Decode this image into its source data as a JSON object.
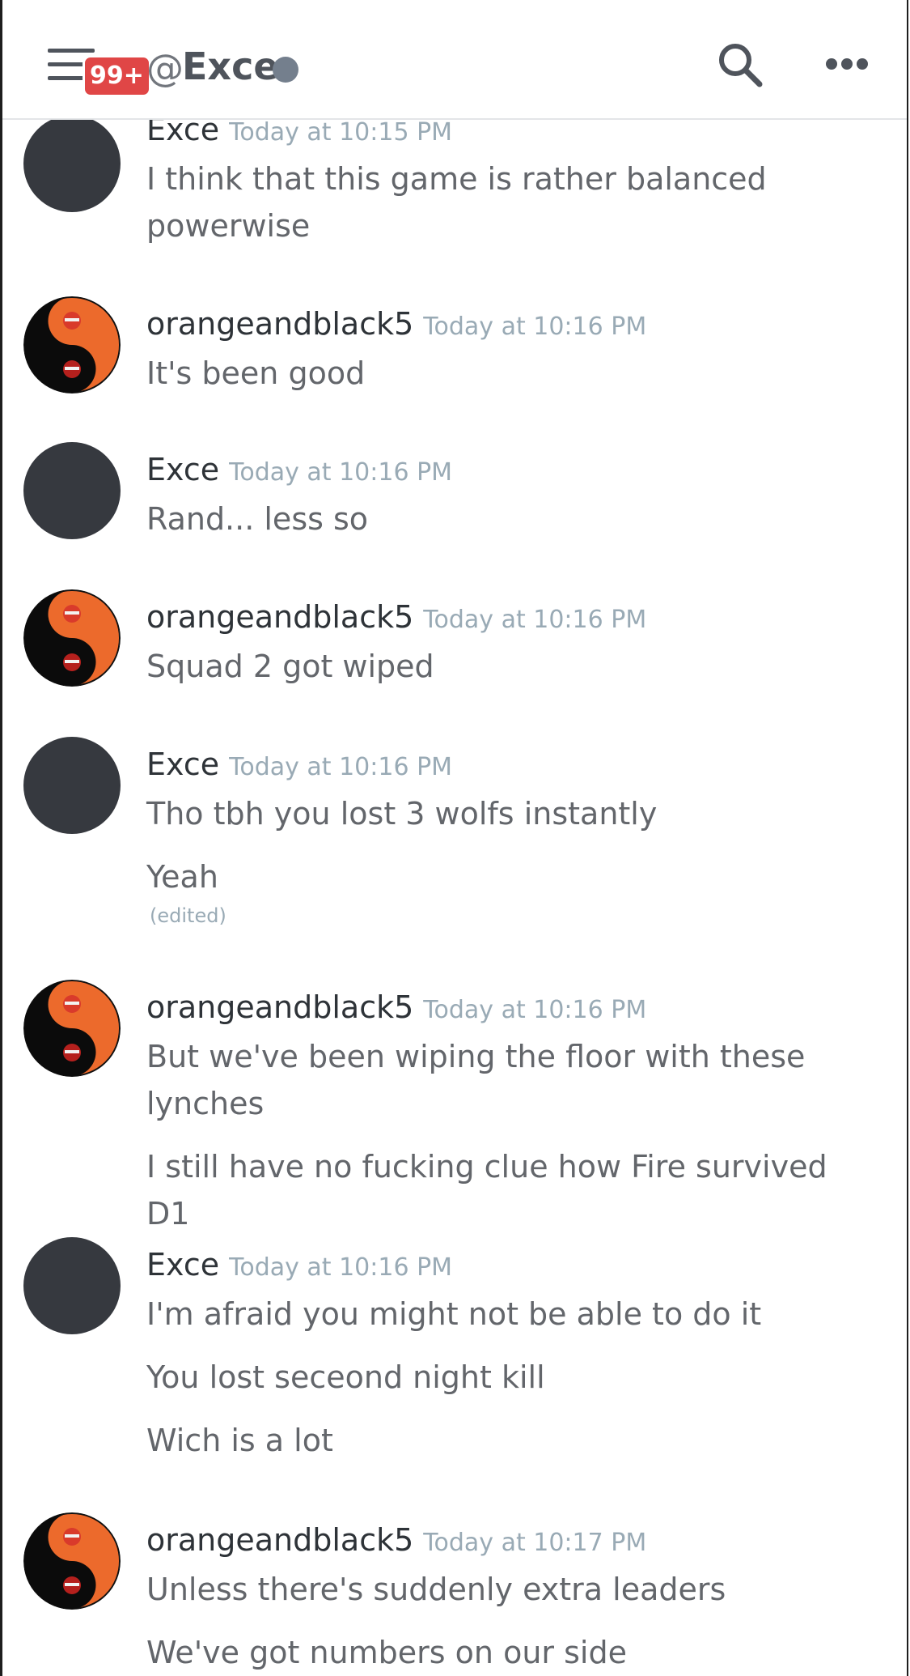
{
  "header": {
    "badge": "99+",
    "at": "@",
    "title": "Exce",
    "colors": {
      "status": "#747f8d",
      "badge": "#e04646"
    }
  },
  "messages": [
    {
      "author": "Exce",
      "time": "Today at 10:15 PM",
      "lines": [
        "I think that this game is rather balanced",
        "powerwise"
      ]
    },
    {
      "author": "orangeandblack5",
      "time": "Today at 10:16 PM",
      "lines": [
        "It's been good"
      ]
    },
    {
      "author": "Exce",
      "time": "Today at 10:16 PM",
      "lines": [
        "Rand... less so"
      ]
    },
    {
      "author": "orangeandblack5",
      "time": "Today at 10:16 PM",
      "lines": [
        "Squad 2 got wiped"
      ]
    },
    {
      "author": "Exce",
      "time": "Today at 10:16 PM",
      "lines": [
        "Tho tbh you lost 3 wolfs instantly",
        "Yeah"
      ],
      "edited": "(edited)"
    },
    {
      "author": "orangeandblack5",
      "time": "Today at 10:16 PM",
      "lines": [
        "But we've been wiping the floor with these",
        "lynches",
        "I still have no fucking clue how Fire survived D1"
      ]
    },
    {
      "author": "Exce",
      "time": "Today at 10:16 PM",
      "lines": [
        "I'm afraid you might not be able to do it",
        "You lost seceond night kill",
        "Wich is a lot"
      ]
    },
    {
      "author": "orangeandblack5",
      "time": "Today at 10:17 PM",
      "lines": [
        "Unless there's suddenly extra leaders",
        "We've got numbers on our side"
      ]
    }
  ]
}
